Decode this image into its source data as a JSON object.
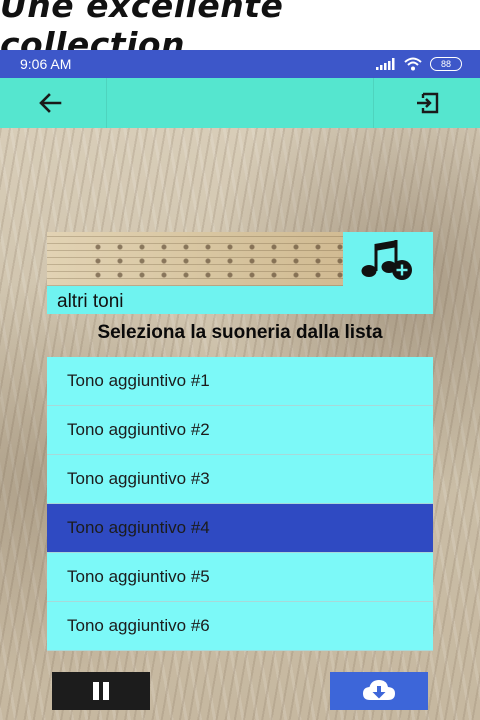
{
  "promo": {
    "text": "Une excellente collection"
  },
  "status_bar": {
    "time": "9:06 AM",
    "battery": "88"
  },
  "toolbar": {
    "back_icon": "arrow-left-icon",
    "exit_icon": "exit-icon"
  },
  "card": {
    "label": "altri toni",
    "badge_icon": "music-add-icon",
    "subtitle": "Seleziona la suoneria dalla lista"
  },
  "ringtones": [
    {
      "label": "Tono aggiuntivo #1",
      "selected": false
    },
    {
      "label": "Tono aggiuntivo #2",
      "selected": false
    },
    {
      "label": "Tono aggiuntivo #3",
      "selected": false
    },
    {
      "label": "Tono aggiuntivo #4",
      "selected": true
    },
    {
      "label": "Tono aggiuntivo #5",
      "selected": false
    },
    {
      "label": "Tono aggiuntivo #6",
      "selected": false
    }
  ],
  "controls": {
    "pause_icon": "pause-icon",
    "download_icon": "cloud-download-icon"
  },
  "colors": {
    "toolbar": "#55e6cf",
    "status_bar": "#3d57c9",
    "list_row": "#7cf9f8",
    "list_selected": "#2f4ac2",
    "download_button": "#3d66d9",
    "pause_button": "#1c1c1c"
  }
}
